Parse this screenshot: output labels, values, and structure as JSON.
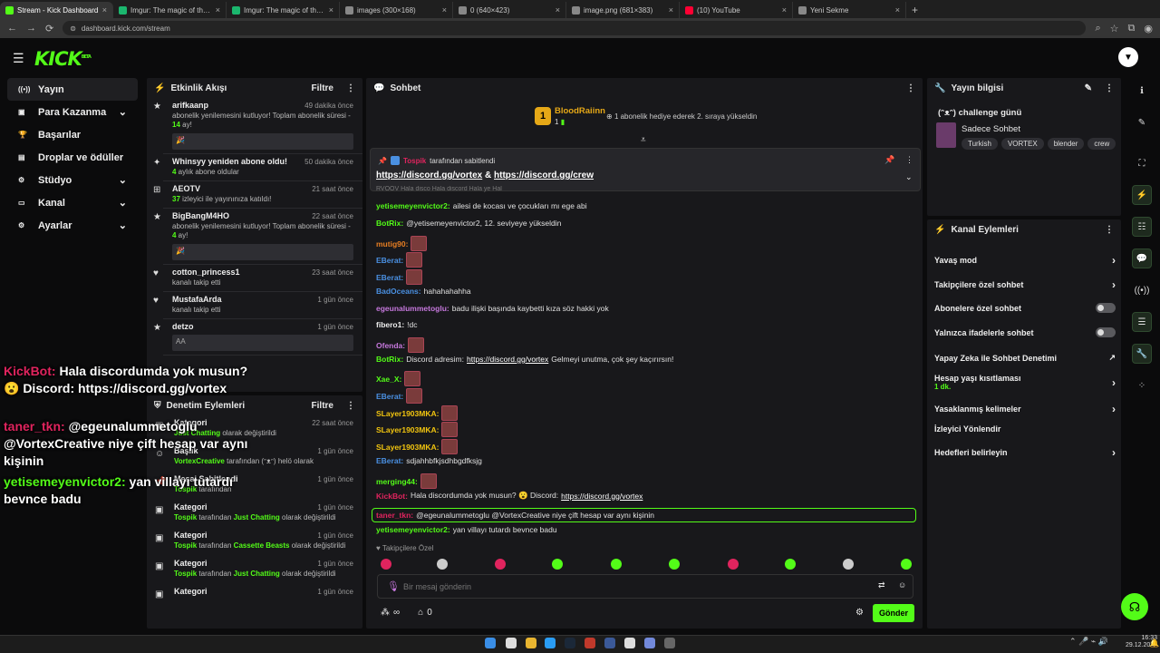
{
  "browser": {
    "tabs": [
      {
        "label": "Stream - Kick Dashboard",
        "color": "#53fc18",
        "active": true
      },
      {
        "label": "Imgur: The magic of the Interne",
        "color": "#1bb76e"
      },
      {
        "label": "Imgur: The magic of the Interne",
        "color": "#1bb76e"
      },
      {
        "label": "images (300×168)",
        "color": "#888"
      },
      {
        "label": "0 (640×423)",
        "color": "#888"
      },
      {
        "label": "image.png (681×383)",
        "color": "#888"
      },
      {
        "label": "(10) YouTube",
        "color": "#ff0033"
      },
      {
        "label": "Yeni Sekme",
        "color": "#888"
      }
    ],
    "url": "dashboard.kick.com/stream"
  },
  "brand": {
    "logo": "KICK",
    "beta": "BETA"
  },
  "nav": [
    {
      "label": "Yayın",
      "icon": "broadcast-icon",
      "active": true
    },
    {
      "label": "Para Kazanma",
      "icon": "wallet-icon",
      "chev": true
    },
    {
      "label": "Başarılar",
      "icon": "trophy-icon"
    },
    {
      "label": "Droplar ve ödüller",
      "icon": "gift-icon"
    },
    {
      "label": "Stüdyo",
      "icon": "gear-icon",
      "chev": true
    },
    {
      "label": "Kanal",
      "icon": "tv-icon",
      "chev": true
    },
    {
      "label": "Ayarlar",
      "icon": "settings-icon",
      "chev": true
    }
  ],
  "activity": {
    "title": "Etkinlik Akışı",
    "filter": "Filtre",
    "events": [
      {
        "name": "arifkaanp",
        "time": "49 dakika önce",
        "pre": "abonelik yenilemesini kutluyor! Toplam abonelik süresi - ",
        "hl": "14",
        "post": " ay!",
        "box": "🎉"
      },
      {
        "name": "Whinsyy yeniden abone oldu!",
        "time": "50 dakika önce",
        "pre": "",
        "hl": "4",
        "post": " aylık abone oldular"
      },
      {
        "name": "AEOTV",
        "time": "21 saat önce",
        "pre": "",
        "hl": "37",
        "post": " izleyici ile yayınınıza katıldı!"
      },
      {
        "name": "BigBangM4HO",
        "time": "22 saat önce",
        "pre": "abonelik yenilemesini kutluyor! Toplam abonelik süresi - ",
        "hl": "4",
        "post": " ay!",
        "box": "🎉"
      },
      {
        "name": "cotton_princess1",
        "time": "23 saat önce",
        "pre": "kanalı takip etti",
        "hl": "",
        "post": ""
      },
      {
        "name": "MustafaArda",
        "time": "1 gün önce",
        "pre": "kanalı takip etti",
        "hl": "",
        "post": ""
      },
      {
        "name": "detzo",
        "time": "1 gün önce",
        "pre": "",
        "hl": "",
        "post": "",
        "box": "ΑΑ"
      }
    ]
  },
  "moderation": {
    "title": "Denetim Eylemleri",
    "filter": "Filtre",
    "events": [
      {
        "name": "Kategori",
        "time": "22 saat önce",
        "who": "",
        "mid": "",
        "hl2": "Just Chatting",
        "post": " olarak değiştirildi"
      },
      {
        "name": "Başlık",
        "time": "1 gün önce",
        "who": "VortexCreative",
        "mid": " tarafından ",
        "hl2": "",
        "post": "(ᵔᴥᵔ) helö olarak"
      },
      {
        "name": "Mesaj Sabitlendi",
        "time": "1 gün önce",
        "who": "Tospik",
        "mid": " tarafından",
        "hl2": "",
        "post": ""
      },
      {
        "name": "Kategori",
        "time": "1 gün önce",
        "who": "Tospik",
        "mid": " tarafından ",
        "hl2": "Just Chatting",
        "post": " olarak değiştirildi"
      },
      {
        "name": "Kategori",
        "time": "1 gün önce",
        "who": "Tospik",
        "mid": " tarafından ",
        "hl2": "Cassette Beasts",
        "post": " olarak değiştirildi"
      },
      {
        "name": "Kategori",
        "time": "1 gün önce",
        "who": "Tospik",
        "mid": " tarafından ",
        "hl2": "Just Chatting",
        "post": " olarak değiştirildi"
      },
      {
        "name": "Kategori",
        "time": "1 gün önce",
        "who": "",
        "mid": "",
        "hl2": "",
        "post": ""
      }
    ]
  },
  "overlay": {
    "lines": [
      {
        "user": "KickBot:",
        "color": "#e0245e",
        "text": " Hala discordumda yok musun? 😮 Discord: https://discord.gg/vortex"
      },
      {
        "user": "taner_tkn:",
        "color": "#e0245e",
        "text": " @egeunalummetoglu @VortexCreative niye çift hesap var aynı kişinin"
      },
      {
        "user": "yetisemeyenvictor2:",
        "color": "#53fc18",
        "text": " yan villayı tutardı bevnce badu"
      }
    ]
  },
  "chat": {
    "title": "Sohbet",
    "gift": {
      "user": "BloodRaiinn",
      "count": "1",
      "text": "1 abonelik hediye ederek 2. sıraya yükseldin"
    },
    "pinned": {
      "by": "Tospik",
      "by_suffix": " tarafından sabitlendi",
      "link1": "https://discord.gg/vortex",
      "amp": " & ",
      "link2": "https://discord.gg/crew",
      "partial": "RVOOV Hala disco Hala discord Hala ye Hal"
    },
    "messages": [
      {
        "user": "yetisemeyenvictor2:",
        "color": "#53fc18",
        "text": " ailesi de kocası ve çocukları mı ege abi"
      },
      {
        "user": "BotRix:",
        "color": "#53fc18",
        "text": " @yetisemeyenvictor2, 12. seviyeye yükseldin"
      },
      {
        "user": "mutig90:",
        "color": "#e67e22",
        "text": ""
      },
      {
        "user": "EBerat:",
        "color": "#4a90e2",
        "text": ""
      },
      {
        "user": "EBerat:",
        "color": "#4a90e2",
        "text": ""
      },
      {
        "user": "BadOceans:",
        "color": "#4a90e2",
        "text": " hahahahahha"
      },
      {
        "user": "egeunalummetoglu:",
        "color": "#c678dd",
        "text": " badu ilişki başında kaybetti kıza söz hakki yok"
      },
      {
        "user": "fibero1:",
        "color": "#eee",
        "text": " !dc"
      },
      {
        "user": "Ofenda:",
        "color": "#c678dd",
        "text": ""
      },
      {
        "user": "BotRix:",
        "color": "#53fc18",
        "text": " Discord adresim: ",
        "link": "https://discord.gg/vortex",
        "post": " Gelmeyi unutma, çok şey kaçırırsın!"
      },
      {
        "user": "Xae_X:",
        "color": "#53fc18",
        "text": ""
      },
      {
        "user": "EBerat:",
        "color": "#4a90e2",
        "text": ""
      },
      {
        "user": "SLayer1903MKA:",
        "color": "#f1c40f",
        "text": ""
      },
      {
        "user": "SLayer1903MKA:",
        "color": "#f1c40f",
        "text": ""
      },
      {
        "user": "SLayer1903MKA:",
        "color": "#f1c40f",
        "text": ""
      },
      {
        "user": "EBerat:",
        "color": "#4a90e2",
        "text": " sdjahhbfkjsdhbgdfksjg"
      },
      {
        "user": "merging44:",
        "color": "#53fc18",
        "text": ""
      },
      {
        "user": "KickBot:",
        "color": "#e0245e",
        "text": " Hala discordumda yok musun? 😮 Discord: ",
        "link": "https://discord.gg/vortex"
      },
      {
        "user": "taner_tkn:",
        "color": "#e0245e",
        "text": " @egeunalummetoglu @VortexCreative niye çift hesap var aynı kişinin"
      },
      {
        "user": "yetisemeyenvictor2:",
        "color": "#53fc18",
        "text": " yan villayı tutardı bevnce badu"
      }
    ],
    "followers_only": "Takipçilere Özel",
    "placeholder": "Bir mesaj gönderin",
    "points": "0",
    "send": "Gönder",
    "infinity": "∞"
  },
  "streaminfo": {
    "title": "Yayın bilgisi",
    "stream_title": "(ᵔᴥᵔ) challenge günü",
    "category": "Sadece Sohbet",
    "tags": [
      "Turkish",
      "VORTEX",
      "blender",
      "crew"
    ]
  },
  "actions": {
    "title": "Kanal Eylemleri",
    "items": [
      {
        "label": "Yavaş mod",
        "type": "arrow"
      },
      {
        "label": "Takipçilere özel sohbet",
        "type": "arrow"
      },
      {
        "label": "Abonelere özel sohbet",
        "type": "toggle"
      },
      {
        "label": "Yalnızca ifadelerle sohbet",
        "type": "toggle"
      },
      {
        "label": "Yapay Zeka ile Sohbet Denetimi",
        "type": "ext"
      },
      {
        "label": "Hesap yaşı kısıtlaması",
        "type": "arrow",
        "sub": "1 dk."
      },
      {
        "label": "Yasaklanmış kelimeler",
        "type": "arrow"
      },
      {
        "label": "İzleyici Yönlendir",
        "type": "none"
      },
      {
        "label": "Hedefleri belirleyin",
        "type": "arrow"
      }
    ]
  },
  "taskbar": {
    "time": "16:33",
    "date": "29.12.2025"
  }
}
